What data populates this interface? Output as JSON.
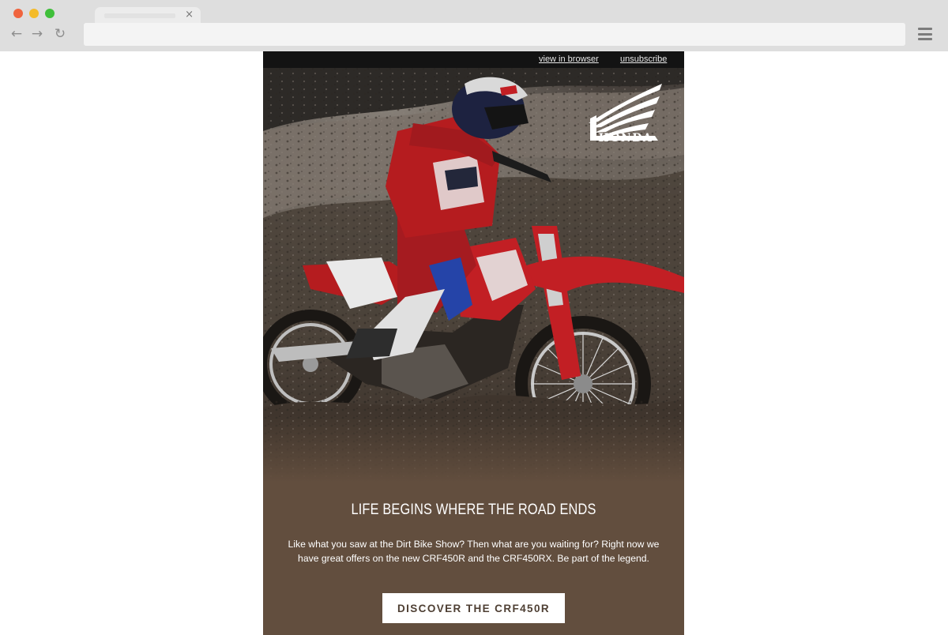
{
  "browser": {
    "tab_close": "×",
    "icons": {
      "back": "arrow-left-icon",
      "forward": "arrow-right-icon",
      "reload": "reload-icon",
      "menu": "hamburger-menu-icon"
    },
    "glyphs": {
      "back": "←",
      "forward": "→",
      "reload": "↻"
    },
    "address_value": ""
  },
  "email": {
    "top_links": {
      "view_in_browser": "view in browser",
      "unsubscribe": "unsubscribe"
    },
    "logo_text": "HONDA",
    "headline": "LIFE BEGINS WHERE THE ROAD ENDS",
    "body": "Like what you saw at the Dirt Bike Show? Then what are you waiting for? Right now we have great offers on the new CRF450R and the CRF450RX. Be part of the legend.",
    "cta_label": "DISCOVER THE CRF450R",
    "colors": {
      "background": "#624e3e",
      "topbar": "#131313",
      "cta_bg": "#ffffff",
      "cta_text": "#4e3f33",
      "bike_red": "#b51c1f"
    }
  }
}
